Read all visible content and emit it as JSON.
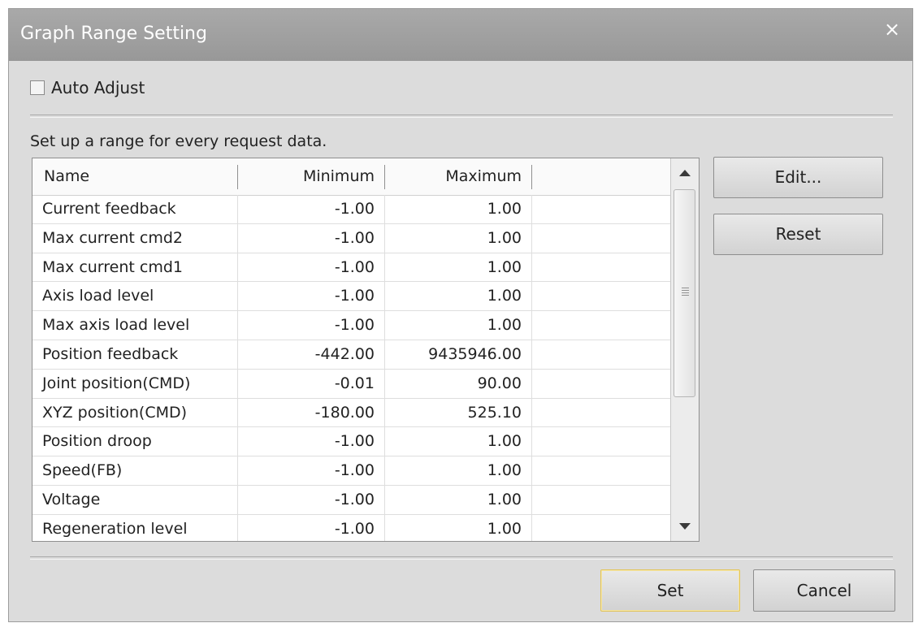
{
  "window": {
    "title": "Graph Range Setting",
    "close_glyph": "×"
  },
  "auto_adjust": {
    "label": "Auto Adjust",
    "checked": false
  },
  "instructions": "Set up a range for every request data.",
  "table": {
    "columns": {
      "name": "Name",
      "minimum": "Minimum",
      "maximum": "Maximum"
    },
    "rows": [
      {
        "name": "Current feedback",
        "min": "-1.00",
        "max": "1.00"
      },
      {
        "name": "Max current cmd2",
        "min": "-1.00",
        "max": "1.00"
      },
      {
        "name": "Max current cmd1",
        "min": "-1.00",
        "max": "1.00"
      },
      {
        "name": "Axis load level",
        "min": "-1.00",
        "max": "1.00"
      },
      {
        "name": "Max axis load level",
        "min": "-1.00",
        "max": "1.00"
      },
      {
        "name": "Position feedback",
        "min": "-442.00",
        "max": "9435946.00"
      },
      {
        "name": "Joint position(CMD)",
        "min": "-0.01",
        "max": "90.00"
      },
      {
        "name": "XYZ position(CMD)",
        "min": "-180.00",
        "max": "525.10"
      },
      {
        "name": "Position droop",
        "min": "-1.00",
        "max": "1.00"
      },
      {
        "name": "Speed(FB)",
        "min": "-1.00",
        "max": "1.00"
      },
      {
        "name": "Voltage",
        "min": "-1.00",
        "max": "1.00"
      },
      {
        "name": "Regeneration level",
        "min": "-1.00",
        "max": "1.00"
      }
    ]
  },
  "buttons": {
    "edit": "Edit...",
    "reset": "Reset",
    "set": "Set",
    "cancel": "Cancel"
  },
  "icons": {
    "close": "close-icon",
    "scroll_up": "arrow-up-icon",
    "scroll_down": "arrow-down-icon"
  },
  "colors": {
    "titlebar": "#a3a3a3",
    "dialog_bg": "#dcdcdc",
    "default_button_border": "#e2c45a"
  }
}
